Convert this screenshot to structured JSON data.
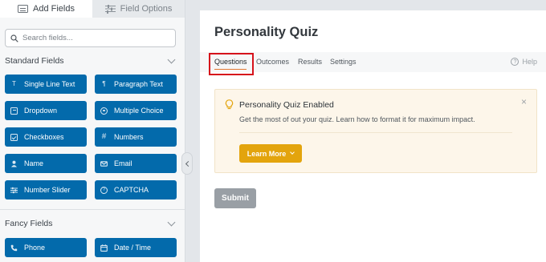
{
  "sidebar": {
    "tabs": [
      {
        "label": "Add Fields",
        "icon": "list-icon",
        "active": true
      },
      {
        "label": "Field Options",
        "icon": "sliders-icon",
        "active": false
      }
    ],
    "search": {
      "placeholder": "Search fields..."
    },
    "standard": {
      "heading": "Standard Fields",
      "fields": [
        {
          "label": "Single Line Text",
          "icon": "text-cursor-icon"
        },
        {
          "label": "Paragraph Text",
          "icon": "paragraph-icon"
        },
        {
          "label": "Dropdown",
          "icon": "dropdown-icon"
        },
        {
          "label": "Multiple Choice",
          "icon": "radio-icon"
        },
        {
          "label": "Checkboxes",
          "icon": "checkbox-icon"
        },
        {
          "label": "Numbers",
          "icon": "hash-icon"
        },
        {
          "label": "Name",
          "icon": "user-icon"
        },
        {
          "label": "Email",
          "icon": "envelope-icon"
        },
        {
          "label": "Number Slider",
          "icon": "sliders-icon"
        },
        {
          "label": "CAPTCHA",
          "icon": "question-circle-icon"
        }
      ]
    },
    "fancy": {
      "heading": "Fancy Fields",
      "fields": [
        {
          "label": "Phone",
          "icon": "phone-icon"
        },
        {
          "label": "Date / Time",
          "icon": "calendar-icon"
        }
      ]
    }
  },
  "form": {
    "title": "Personality Quiz",
    "tabs": [
      "Questions",
      "Outcomes",
      "Results",
      "Settings"
    ],
    "help": "Help",
    "notice": {
      "title": "Personality Quiz Enabled",
      "body": "Get the most of out your quiz. Learn how to format it for maximum impact.",
      "button": "Learn More",
      "close": "×"
    },
    "submit": "Submit"
  },
  "colors": {
    "field_button": "#036aab",
    "accent_orange": "#e27730",
    "learn_more": "#e3a40d",
    "highlight_box": "#d6121b"
  }
}
